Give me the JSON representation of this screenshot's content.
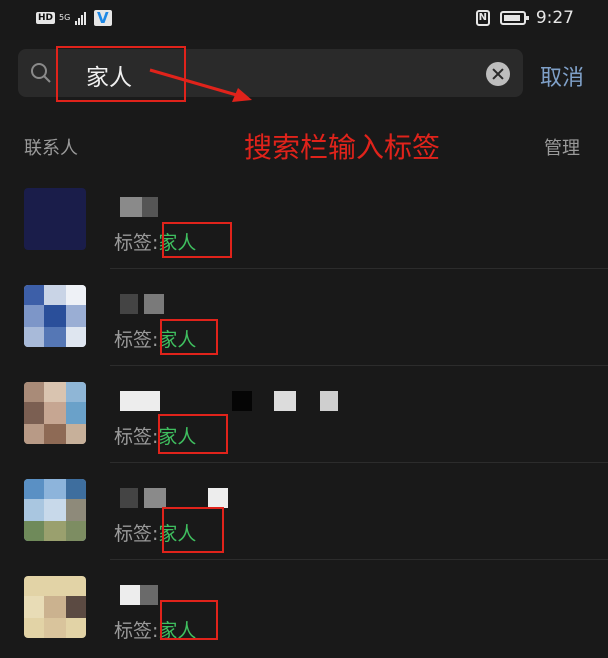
{
  "status_bar": {
    "hd": "HD",
    "network": "5G",
    "time": "9:27",
    "nfc": "N"
  },
  "search": {
    "value": "家人",
    "cancel_label": "取消"
  },
  "annotation": {
    "text": "搜索栏输入标签",
    "color": "#e0231b"
  },
  "section": {
    "title": "联系人",
    "manage_label": "管理"
  },
  "contacts": [
    {
      "tag_label": "标签:",
      "tag_value": "家人"
    },
    {
      "tag_label": "标签:",
      "tag_value": "家人"
    },
    {
      "tag_label": "标签:",
      "tag_value": "家人"
    },
    {
      "tag_label": "标签:",
      "tag_value": "家人"
    },
    {
      "tag_label": "标签:",
      "tag_value": "家人"
    }
  ],
  "colors": {
    "background": "#191919",
    "tag_green": "#3fbf5f",
    "cancel_blue": "#7fa0c8"
  }
}
